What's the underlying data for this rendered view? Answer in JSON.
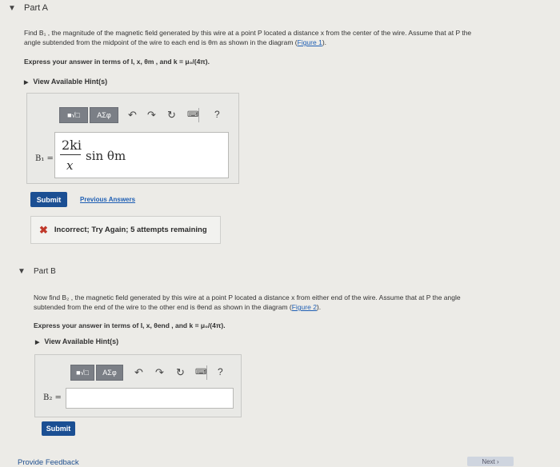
{
  "partA": {
    "title": "Part A",
    "prompt_line1": "Find B₁ , the magnitude of the magnetic field generated by this wire at a point P located a distance x from the center of the wire. Assume that at P the",
    "prompt_line2_pre": "angle subtended from the midpoint of the wire to each end is θm as shown in the diagram (",
    "figure_link": "Figure 1",
    "prompt_line2_post": ").",
    "express": "Express your answer in terms of I, x, θm , and k = μ₀/(4π).",
    "hint_label": "View Available Hint(s)",
    "toolbar": {
      "templates": "■√□",
      "greek": "AΣφ",
      "help": "?"
    },
    "answer_label": "B₁ =",
    "answer_numerator": "2ki",
    "answer_denominator": "x",
    "answer_trail": "sin θm",
    "submit": "Submit",
    "previous_answers": "Previous Answers",
    "feedback": "Incorrect; Try Again; 5 attempts remaining"
  },
  "partB": {
    "title": "Part B",
    "prompt_line1": "Now find B₂ , the magnetic field generated by this wire at a point P located a distance x from either end of the wire. Assume that at P the angle",
    "prompt_line2_pre": "subtended from the end of the wire to the other end is θend as shown in the diagram (",
    "figure_link": "Figure 2",
    "prompt_line2_post": ").",
    "express": "Express your answer in terms of I, x, θend , and k = μ₀/(4π).",
    "hint_label": "View Available Hint(s)",
    "toolbar": {
      "templates": "■√□",
      "greek": "AΣφ",
      "help": "?"
    },
    "answer_label": "B₂ =",
    "answer_value": "",
    "submit": "Submit"
  },
  "footer": {
    "provide_feedback": "Provide Feedback",
    "next": "Next ›"
  },
  "icons": {
    "collapse": "caret-down-icon",
    "expand": "caret-right-icon",
    "incorrect": "x-mark-icon"
  }
}
